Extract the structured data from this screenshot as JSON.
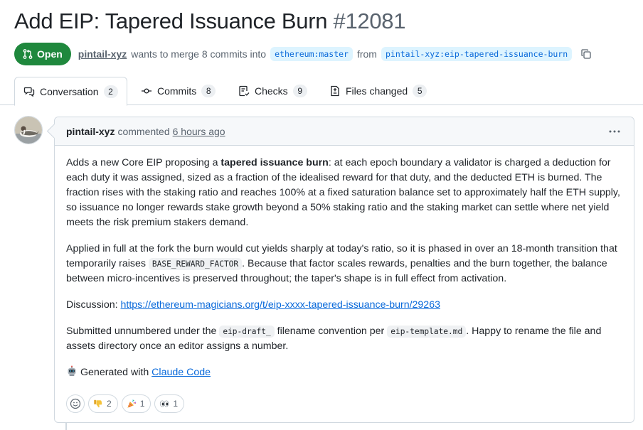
{
  "pr": {
    "title": "Add EIP: Tapered Issuance Burn",
    "number": "#12081",
    "state": "Open",
    "author": "pintail-xyz",
    "merge_text_1": "wants to merge 8 commits into",
    "base_branch": "ethereum:master",
    "merge_text_2": "from",
    "head_branch": "pintail-xyz:eip-tapered-issuance-burn"
  },
  "tabs": [
    {
      "label": "Conversation",
      "count": "2",
      "icon": "comment-discussion-icon",
      "selected": true
    },
    {
      "label": "Commits",
      "count": "8",
      "icon": "git-commit-icon",
      "selected": false
    },
    {
      "label": "Checks",
      "count": "9",
      "icon": "checklist-icon",
      "selected": false
    },
    {
      "label": "Files changed",
      "count": "5",
      "icon": "file-diff-icon",
      "selected": false
    }
  ],
  "comment": {
    "author": "pintail-xyz",
    "verb": "commented",
    "time": "6 hours ago",
    "p1_a": "Adds a new Core EIP proposing a ",
    "p1_bold": "tapered issuance burn",
    "p1_b": ": at each epoch boundary a validator is charged a deduction for each duty it was assigned, sized as a fraction of the idealised reward for that duty, and the deducted ETH is burned. The fraction rises with the staking ratio and reaches 100% at a fixed saturation balance set to approximately half the ETH supply, so issuance no longer rewards stake growth beyond a 50% staking ratio and the staking market can settle where net yield meets the risk premium stakers demand.",
    "p2_a": "Applied in full at the fork the burn would cut yields sharply at today's ratio, so it is phased in over an 18-month transition that temporarily raises ",
    "p2_code": "BASE_REWARD_FACTOR",
    "p2_b": ". Because that factor scales rewards, penalties and the burn together, the balance between micro-incentives is preserved throughout; the taper's shape is in full effect from activation.",
    "p3_label": "Discussion: ",
    "p3_link": "https://ethereum-magicians.org/t/eip-xxxx-tapered-issuance-burn/29263",
    "p4_a": "Submitted unnumbered under the ",
    "p4_code1": "eip-draft_",
    "p4_b": " filename convention per ",
    "p4_code2": "eip-template.md",
    "p4_c": ". Happy to rename the file and assets directory once an editor assigns a number.",
    "p5_text": "Generated with ",
    "p5_link": "Claude Code"
  },
  "reactions": [
    {
      "icon": "thumbs-down-icon",
      "count": "2"
    },
    {
      "icon": "party-popper-icon",
      "count": "1"
    },
    {
      "icon": "eyes-icon",
      "count": "1"
    }
  ],
  "colors": {
    "open_green": "#1f883d",
    "link_blue": "#0969da",
    "branch_bg": "#ddf4ff",
    "border": "#d1d9e0"
  }
}
